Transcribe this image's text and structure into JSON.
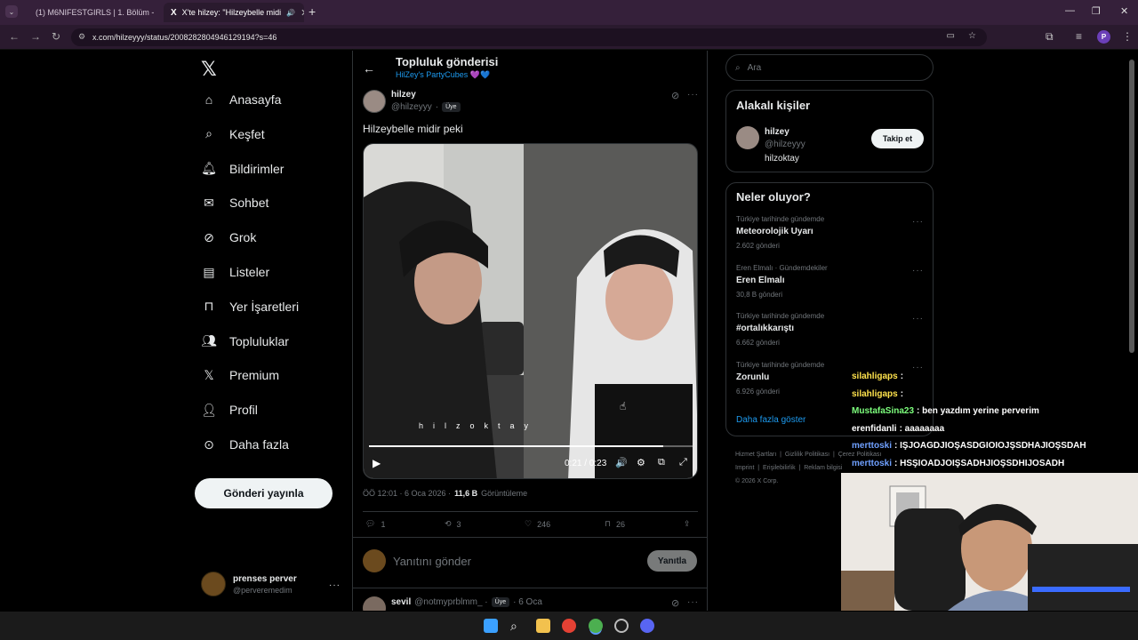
{
  "browser": {
    "tabs": [
      {
        "label": "(1) M6NIFESTGIRLS | 1. Bölüm -",
        "active": false
      },
      {
        "label": "X'te hilzey: \"Hilzeybelle midi",
        "active": true
      }
    ],
    "url": "x.com/hilzeyyy/status/2008282804946129194?s=46",
    "profile_letter": "P"
  },
  "sidebar": {
    "items": [
      {
        "label": "Anasayfa",
        "icon": "home-icon"
      },
      {
        "label": "Keşfet",
        "icon": "search-icon"
      },
      {
        "label": "Bildirimler",
        "icon": "bell-icon"
      },
      {
        "label": "Sohbet",
        "icon": "mail-icon"
      },
      {
        "label": "Grok",
        "icon": "grok-icon"
      },
      {
        "label": "Listeler",
        "icon": "list-icon"
      },
      {
        "label": "Yer İşaretleri",
        "icon": "bookmark-icon"
      },
      {
        "label": "Topluluklar",
        "icon": "people-icon"
      },
      {
        "label": "Premium",
        "icon": "x-logo-icon"
      },
      {
        "label": "Profil",
        "icon": "person-icon"
      },
      {
        "label": "Daha fazla",
        "icon": "more-circle-icon"
      }
    ],
    "post_button": "Gönderi yayınla",
    "account": {
      "name": "prenses perver",
      "handle": "@perveremedim"
    }
  },
  "header": {
    "title": "Topluluk gönderisi",
    "subtitle": "HilZey's PartyCubes 💜💙"
  },
  "post": {
    "name": "hilzey",
    "handle": "@hilzeyyy",
    "dot": "·",
    "member_badge": "Üye",
    "text": "Hilzeybelle midir peki",
    "video": {
      "watermark": "h  i  l  z  o  k  t  a  y",
      "time": "0:21 / 0:23",
      "progress": 0.91
    },
    "meta_time": "ÖÖ 12:01 · 6 Oca 2026 ·",
    "views": "11,6 B",
    "views_label": "Görüntüleme",
    "stats": {
      "replies": "1",
      "reposts": "3",
      "likes": "246",
      "bookmarks": "26"
    }
  },
  "reply": {
    "placeholder": "Yanıtını gönder",
    "button": "Yanıtla"
  },
  "next_post": {
    "name": "sevil",
    "handle": "@notmyprblmm_ ·",
    "badge": "Üye",
    "date": "· 6 Oca"
  },
  "search": {
    "placeholder": "Ara"
  },
  "relevant": {
    "title": "Alakalı kişiler",
    "name": "hilzey",
    "handle": "@hilzeyyy",
    "bio": "hilzoktay",
    "follow": "Takip et"
  },
  "trends": {
    "title": "Neler oluyor?",
    "items": [
      {
        "context": "Türkiye tarihinde gündemde",
        "name": "Meteorolojik Uyarı",
        "count": "2.602 gönderi"
      },
      {
        "context": "Eren Elmalı · Gündemdekiler",
        "name": "Eren Elmalı",
        "count": "30,8 B gönderi"
      },
      {
        "context": "Türkiye tarihinde gündemde",
        "name": "#ortalıkkarıştı",
        "count": "6.662 gönderi"
      },
      {
        "context": "Türkiye tarihinde gündemde",
        "name": "Zorunlu",
        "count": "6.926 gönderi"
      }
    ],
    "show_more": "Daha fazla göster"
  },
  "footer": {
    "links": [
      "Hizmet Şartları",
      "Gizlilik Politikası",
      "Çerez Politikası",
      "Imprint",
      "Erişilebilirlik",
      "Reklam bilgisi"
    ],
    "copyright": "© 2026 X Corp."
  },
  "chat": [
    {
      "user": "silahligaps",
      "msg": ":",
      "color": "#ffe34d"
    },
    {
      "user": "silahligaps",
      "msg": ":",
      "color": "#ffe34d"
    },
    {
      "user": "MustafaSina23",
      "msg": ": ben yazdım yerine perverim",
      "color": "#7dff7d"
    },
    {
      "user": "erenfidanli",
      "msg": ": aaaaaaaa",
      "color": "#ffffff"
    },
    {
      "user": "merttoski",
      "msg": ": IŞJOAGDJIOŞASDGIOIOJŞSDHAJIOŞSDAH",
      "color": "#6fa0ff"
    },
    {
      "user": "merttoski",
      "msg": ": HSŞIOADJOIŞSADHJIOŞSDHIJOSADH",
      "color": "#6fa0ff"
    }
  ],
  "colors": {
    "accent": "#1d9bf0",
    "chrome": "#35203a"
  }
}
